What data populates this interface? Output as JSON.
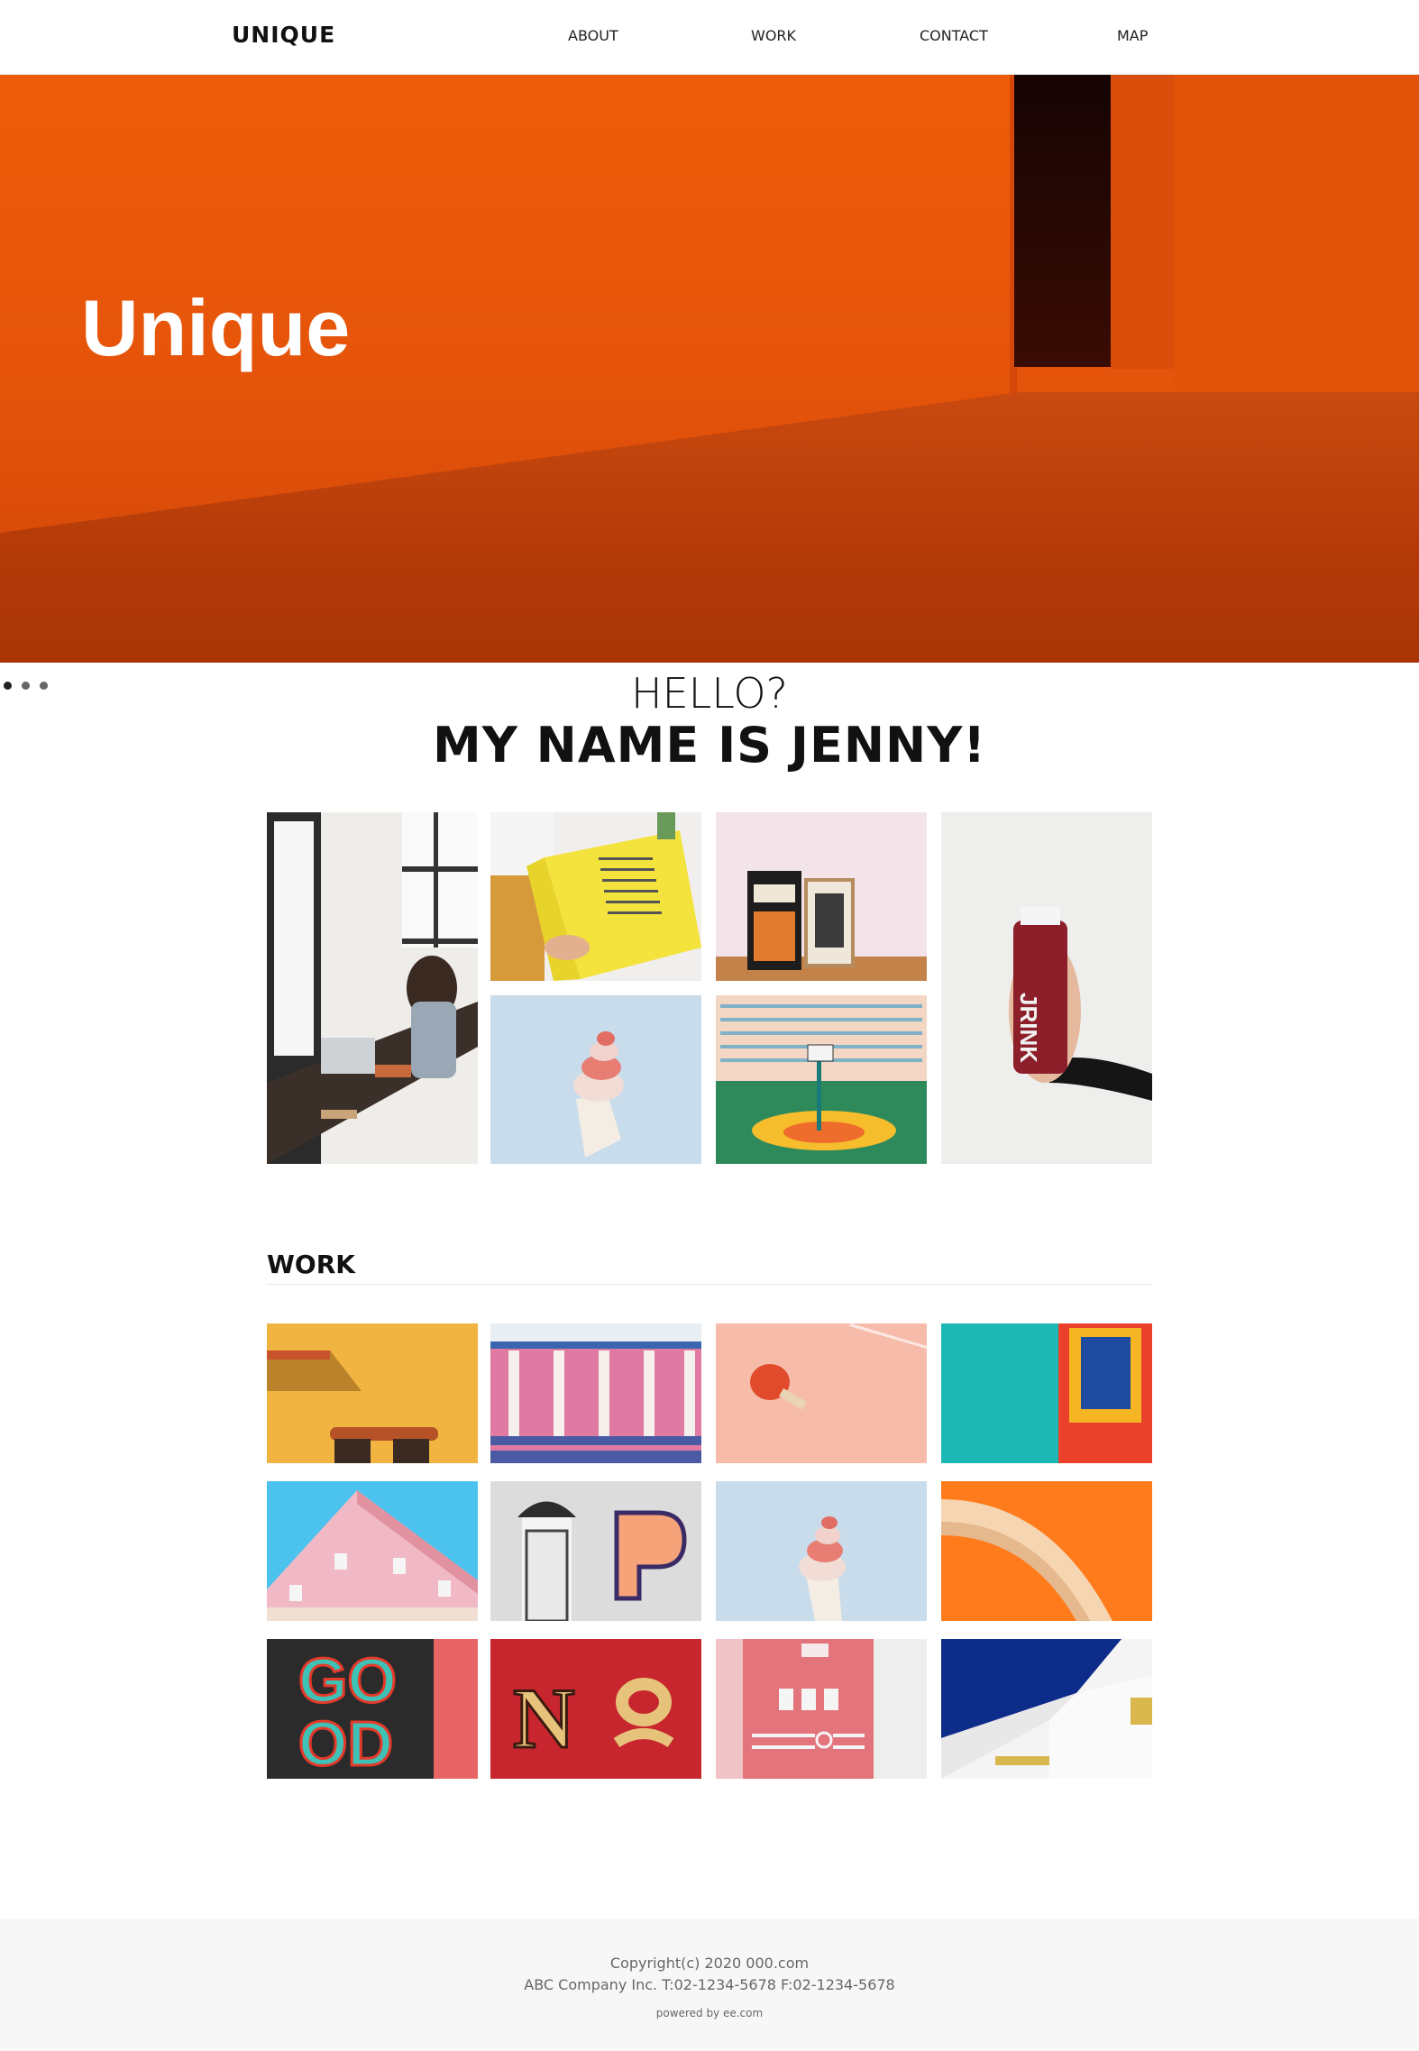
{
  "header": {
    "logo": "UNIQUE",
    "nav": [
      "ABOUT",
      "WORK",
      "CONTACT",
      "MAP"
    ]
  },
  "hero": {
    "title": "Unique",
    "slides": 3,
    "active_slide": 1
  },
  "intro": {
    "greeting": "HELLO?",
    "name_line": "MY NAME IS JENNY!"
  },
  "work": {
    "title": "WORK"
  },
  "footer": {
    "copyright": "Copyright(c) 2020 000.com",
    "company": "ABC Company Inc. T:02-1234-5678 F:02-1234-5678",
    "powered": "powered by ee.com"
  },
  "images": {
    "about": [
      "woman-at-laptop",
      "yellow-magazine",
      "posters-on-floor",
      "ice-cream-sign",
      "basketball-court",
      "juice-bottle"
    ],
    "work": [
      "yellow-wall-windows",
      "pink-building-facade",
      "ping-pong-paddle",
      "teal-wall-window",
      "pink-house-corner",
      "letter-p-wall",
      "ice-cream-sign-2",
      "orange-arc-stairs",
      "good-mural",
      "numero-sign",
      "pink-tower",
      "white-blue-building"
    ]
  }
}
